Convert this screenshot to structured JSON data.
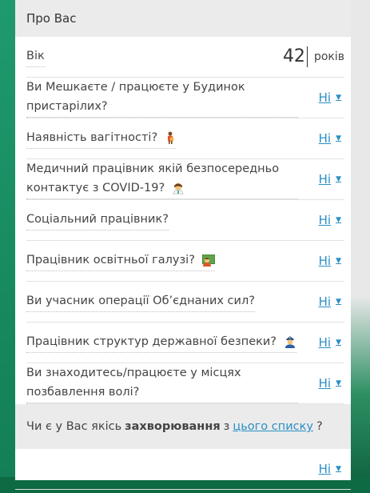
{
  "section_title": "Про Вас",
  "age": {
    "label": "Вік",
    "value": "42",
    "unit": "років"
  },
  "questions": [
    {
      "label": "Ви Мешкаєте / працюєте у Будинок пристарілих?",
      "answer": "Ні",
      "icon": ""
    },
    {
      "label": "Наявність вагітності?",
      "answer": "Ні",
      "icon": "pregnant-woman-emoji"
    },
    {
      "label": "Медичний працівник якій безпосередньо контактує з COVID-19?",
      "answer": "Ні",
      "icon": "health-worker-emoji"
    },
    {
      "label": "Соціальний працівник?",
      "answer": "Ні",
      "icon": ""
    },
    {
      "label": "Працівник освітньої галузі?",
      "answer": "Ні",
      "icon": "teacher-emoji"
    },
    {
      "label": "Ви учасник операції Об’єднаних сил?",
      "answer": "Ні",
      "icon": ""
    },
    {
      "label": "Працівник структур державної безпеки?",
      "answer": "Ні",
      "icon": "police-officer-emoji"
    },
    {
      "label": "Ви знаходитесь/працюєте у місцях позбавлення волі?",
      "answer": "Ні",
      "icon": ""
    }
  ],
  "diseases": {
    "prefix": "Чи є у Вас якісь",
    "bold": "захворювання",
    "middle": "з",
    "link": "цього списку",
    "suffix": "?",
    "answer": "Ні"
  },
  "caret": "▼"
}
